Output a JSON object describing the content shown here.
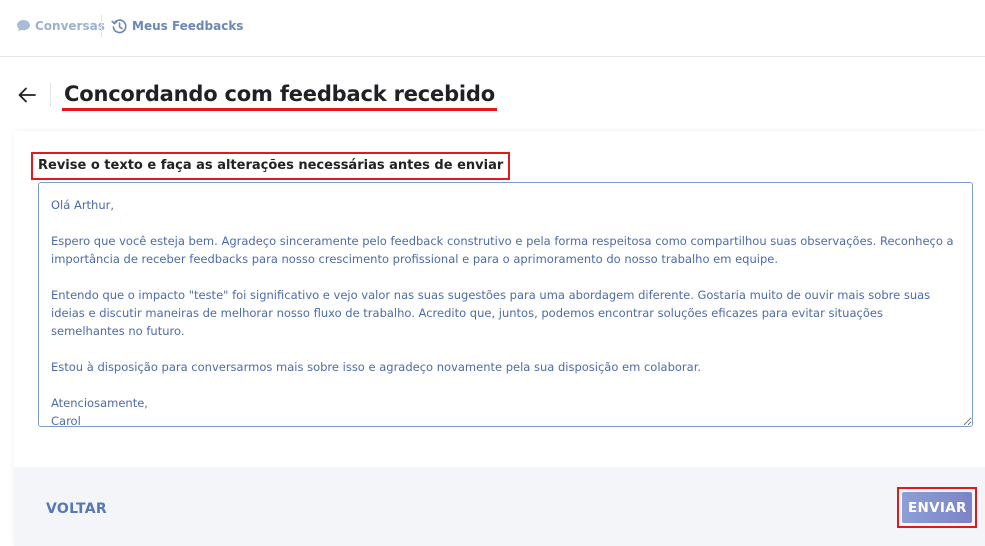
{
  "nav": {
    "items": [
      {
        "label": "Conversas",
        "icon": "chat-bubble-icon"
      },
      {
        "label": "Meus Feedbacks",
        "icon": "history-clock-icon"
      }
    ]
  },
  "header": {
    "title": "Concordando com feedback recebido"
  },
  "form": {
    "instruction": "Revise o texto e faça as alterações necessárias antes de enviar",
    "message": "Olá Arthur,\n\nEspero que você esteja bem. Agradeço sinceramente pelo feedback construtivo e pela forma respeitosa como compartilhou suas observações. Reconheço a importância de receber feedbacks para nosso crescimento profissional e para o aprimoramento do nosso trabalho em equipe.\n\nEntendo que o impacto \"teste\" foi significativo e vejo valor nas suas sugestões para uma abordagem diferente. Gostaria muito de ouvir mais sobre suas ideias e discutir maneiras de melhorar nosso fluxo de trabalho. Acredito que, juntos, podemos encontrar soluções eficazes para evitar situações semelhantes no futuro.\n\nEstou à disposição para conversarmos mais sobre isso e agradeço novamente pela sua disposição em colaborar.\n\nAtenciosamente,\nCarol"
  },
  "actions": {
    "back_label": "VOLTAR",
    "send_label": "ENVIAR"
  },
  "colors": {
    "highlight": "#e0191f",
    "accent": "#5777b5",
    "send_gradient_start": "#8d9fd6",
    "send_gradient_end": "#7d83c6"
  }
}
